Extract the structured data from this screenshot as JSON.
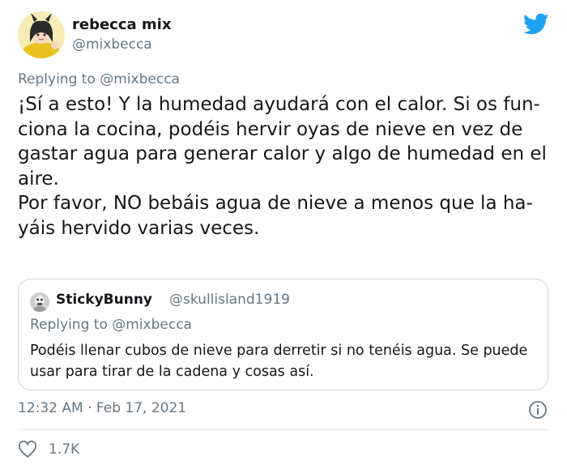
{
  "author": {
    "display_name": "rebecca mix",
    "handle": "@mixbecca"
  },
  "reply_context": {
    "prefix": "Replying to",
    "handle": "@mixbecca"
  },
  "tweet": {
    "paragraph_1": "¡Sí a esto! Y la humedad ayudará con el calor. Si os fun-ciona la cocina, podéis hervir oyas de nieve en vez de gastar agua para generar calor y algo de humedad en el aire.",
    "paragraph_2": "Por favor, NO bebáis agua de nieve a menos que la ha-yáis hervido varias veces."
  },
  "quoted_tweet": {
    "display_name": "StickyBunny",
    "handle": "@skullisland1919",
    "reply_prefix": "Replying to",
    "reply_handle": "@mixbecca",
    "text": "Podéis llenar cubos de nieve para derretir si no tenéis agua. Se puede usar para tirar de la cadena y cosas así."
  },
  "meta": {
    "timestamp": "12:32 AM · Feb 17, 2021"
  },
  "engagement": {
    "likes": "1.7K"
  },
  "colors": {
    "twitter_blue": "#1da1f2",
    "secondary_text": "#657786",
    "border": "#cfd9de"
  },
  "icons": [
    "twitter-bird-icon",
    "info-icon",
    "heart-icon"
  ]
}
